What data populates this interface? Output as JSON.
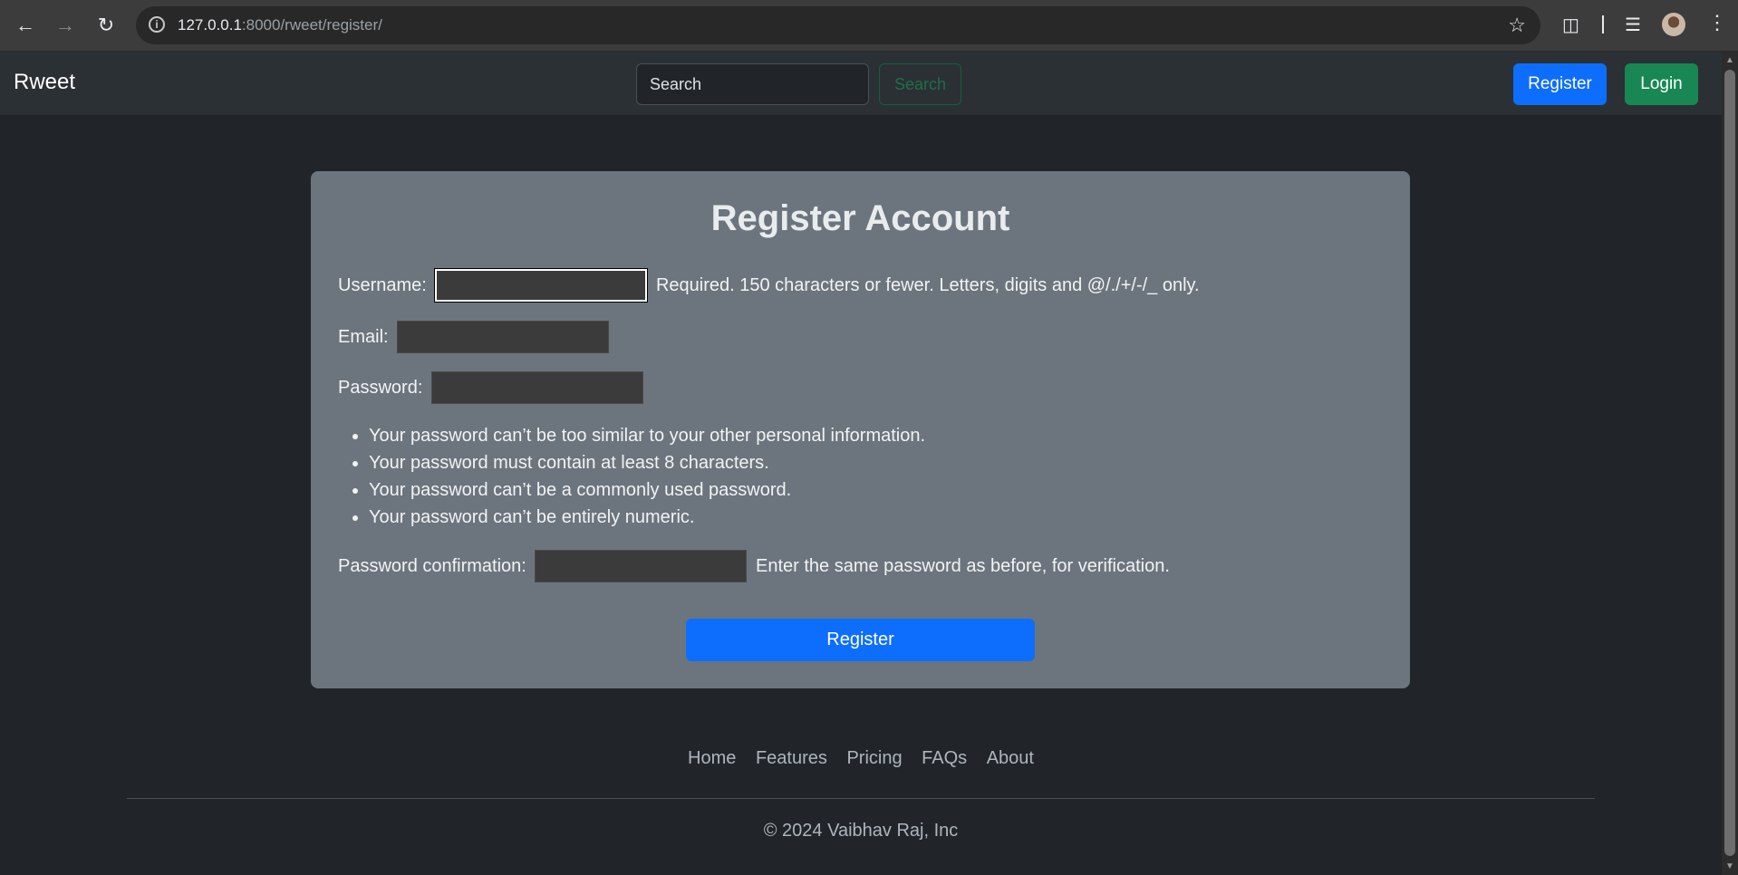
{
  "browser": {
    "url_host": "127.0.0.1",
    "url_rest": ":8000/rweet/register/"
  },
  "navbar": {
    "brand": "Rweet",
    "search_placeholder": "Search",
    "search_button": "Search",
    "register_button": "Register",
    "login_button": "Login"
  },
  "form": {
    "title": "Register Account",
    "username_label": "Username:",
    "username_help": "Required. 150 characters or fewer. Letters, digits and @/./+/-/_ only.",
    "email_label": "Email:",
    "password_label": "Password:",
    "password_rules": [
      "Your password can’t be too similar to your other personal information.",
      "Your password must contain at least 8 characters.",
      "Your password can’t be a commonly used password.",
      "Your password can’t be entirely numeric."
    ],
    "password2_label": "Password confirmation:",
    "password2_help": "Enter the same password as before, for verification.",
    "submit": "Register"
  },
  "footer": {
    "links": [
      "Home",
      "Features",
      "Pricing",
      "FAQs",
      "About"
    ],
    "copyright": "© 2024 Vaibhav Raj, Inc"
  },
  "colors": {
    "page_bg": "#212529",
    "navbar_bg": "#2b3035",
    "card_bg": "#6c757d",
    "primary": "#0d6efd",
    "success": "#198754"
  }
}
